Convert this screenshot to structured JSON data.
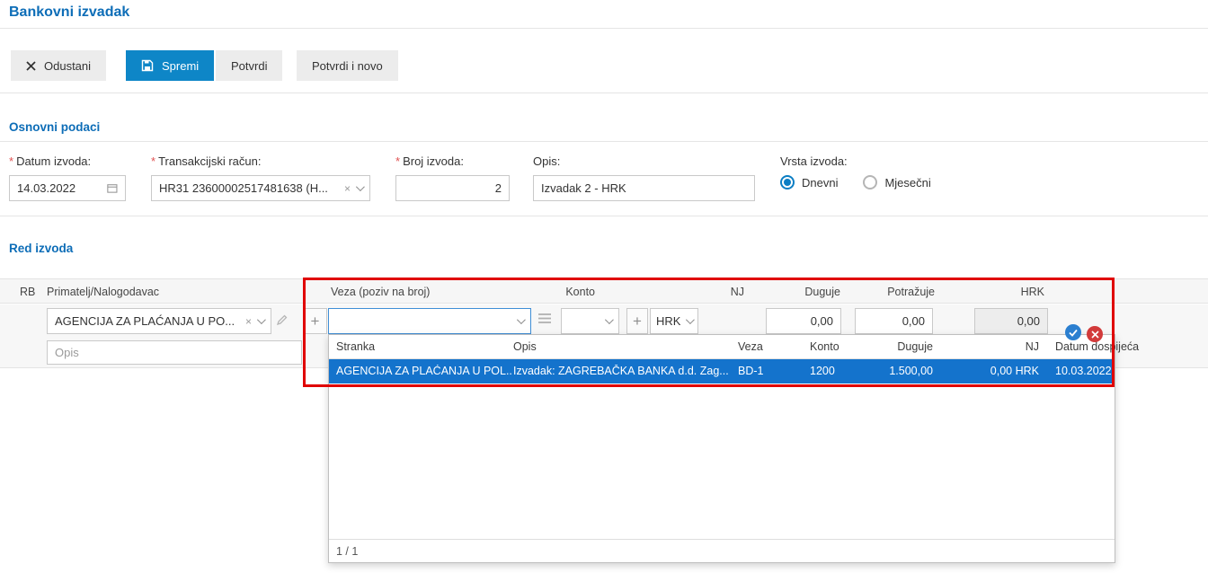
{
  "page": {
    "title": "Bankovni izvadak"
  },
  "toolbar": {
    "cancel": "Odustani",
    "save": "Spremi",
    "confirm": "Potvrdi",
    "confirm_and_new": "Potvrdi i novo"
  },
  "basic": {
    "title": "Osnovni podaci",
    "required_marker": "*",
    "date_label": "Datum izvoda:",
    "date_value": "14.03.2022",
    "account_label": "Transakcijski račun:",
    "account_value": "HR31 23600002517481638 (H...",
    "account_clear": "×",
    "number_label": "Broj izvoda:",
    "number_value": "2",
    "desc_label": "Opis:",
    "desc_value": "Izvadak 2 - HRK",
    "type_label": "Vrsta izvoda:",
    "type_daily": "Dnevni",
    "type_monthly": "Mjesečni"
  },
  "rows": {
    "title": "Red izvoda",
    "headers": {
      "rb": "RB",
      "payee": "Primatelj/Nalogodavac",
      "reference": "Veza (poziv na broj)",
      "account": "Konto",
      "nj": "NJ",
      "debit": "Duguje",
      "credit": "Potražuje",
      "hrk": "HRK"
    },
    "row": {
      "payee_value": "AGENCIJA ZA PLAĆANJA U PO...",
      "payee_clear": "×",
      "add_button": "+",
      "currency": "HRK",
      "debit": "0,00",
      "credit": "0,00",
      "hrk_amount": "0,00",
      "desc_placeholder": "Opis"
    }
  },
  "dropdown": {
    "headers": {
      "stranka": "Stranka",
      "opis": "Opis",
      "veza": "Veza",
      "konto": "Konto",
      "duguje": "Duguje",
      "nj": "NJ",
      "datum": "Datum dospijeća"
    },
    "row": {
      "stranka": "AGENCIJA ZA PLAĆANJA U POL...",
      "opis": "Izvadak: ZAGREBAČKA BANKA d.d. Zag...",
      "veza": "BD-1",
      "konto": "1200",
      "duguje": "1.500,00",
      "nj": "0,00 HRK",
      "datum": "10.03.2022"
    },
    "pagination": "1 / 1"
  },
  "colors": {
    "accent_blue": "#0d6db7",
    "primary_button": "#0e86c7",
    "selected_row": "#1473cc",
    "annotation_red": "#e00000"
  }
}
